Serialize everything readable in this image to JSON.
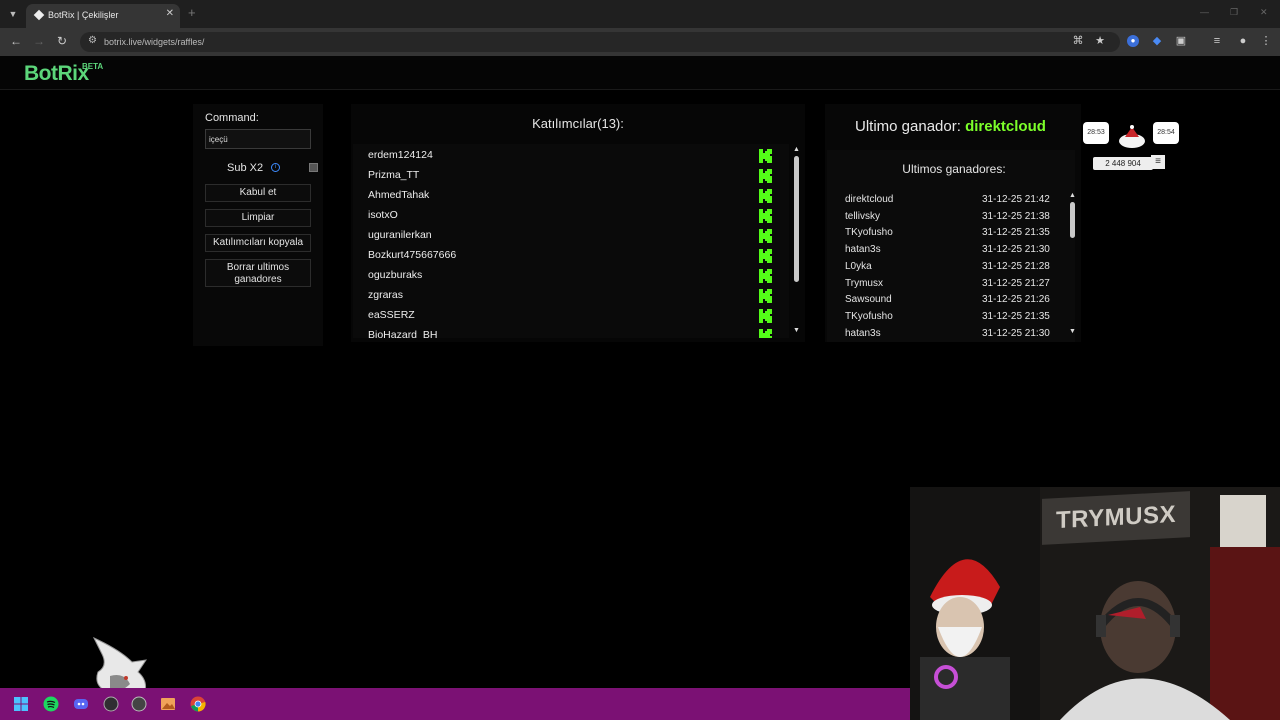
{
  "browser": {
    "tab_title": "BotRix | Çekilişler",
    "url": "botrix.live/widgets/raffles/"
  },
  "site": {
    "logo": "BotRix",
    "logo_badge": "BETA"
  },
  "controls": {
    "command_label": "Command:",
    "command_value": "içeçü",
    "subx2_label": "Sub X2",
    "subx2_checked": false,
    "buttons": [
      "Kabul et",
      "Limpiar",
      "Katılımcıları kopyala",
      "Borrar ultimos ganadores"
    ]
  },
  "participants": {
    "title": "Katılımcılar(13):",
    "platform_icon": "kick-icon",
    "names": [
      "erdem124124",
      "Prizma_TT",
      "AhmedTahak",
      "isotxO",
      "uguranilerkan",
      "Bozkurt475667666",
      "oguzburaks",
      "zgraras",
      "eaSSERZ",
      "BioHazard_BH"
    ]
  },
  "winner": {
    "last_label": "Ultimo ganador:",
    "last_name": "direktcloud",
    "list_title": "Ultimos ganadores:",
    "list": [
      {
        "name": "direktcloud",
        "date": "31-12-25 21:42"
      },
      {
        "name": "tellivsky",
        "date": "31-12-25 21:38"
      },
      {
        "name": "TKyofusho",
        "date": "31-12-25 21:35"
      },
      {
        "name": "hatan3s",
        "date": "31-12-25 21:30"
      },
      {
        "name": "L0yka",
        "date": "31-12-25 21:28"
      },
      {
        "name": "Trymusx",
        "date": "31-12-25 21:27"
      },
      {
        "name": "Sawsound",
        "date": "31-12-25 21:26"
      },
      {
        "name": "TKyofusho",
        "date": "31-12-25 21:35"
      },
      {
        "name": "hatan3s",
        "date": "31-12-25 21:30"
      }
    ]
  },
  "overlay": {
    "timer_left": "28:53",
    "timer_right": "28:54",
    "count": "2 448 904"
  },
  "webcam": {
    "sign_text": "TRYMUSX"
  },
  "colors": {
    "brand_green": "#5cd67a",
    "winner_green": "#7cff2a",
    "kick_green": "#53fc18",
    "taskbar": "#7b1174"
  }
}
